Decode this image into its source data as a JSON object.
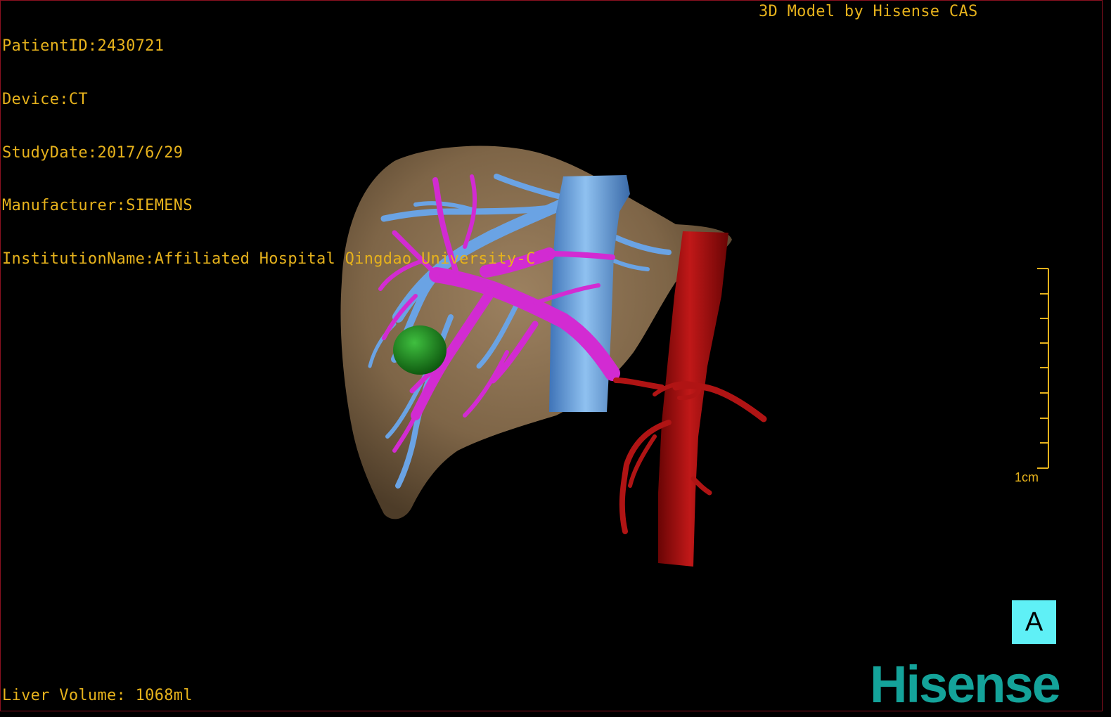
{
  "header": {
    "patient_id": "PatientID:2430721",
    "device": "Device:CT",
    "study_date": "StudyDate:2017/6/29",
    "manufacturer": "Manufacturer:SIEMENS",
    "institution": "InstitutionName:Affiliated Hospital Qingdao University-C"
  },
  "model_credit": "3D Model by Hisense CAS",
  "footer": {
    "liver_volume": "Liver Volume: 1068ml"
  },
  "scale_bar": {
    "label": "1cm"
  },
  "orientation": {
    "label": "A"
  },
  "brand": {
    "logo_text": "Hisense"
  },
  "structures": [
    {
      "name": "liver",
      "color": "#8b7150"
    },
    {
      "name": "hepatic-portal-veins",
      "color": "#d22bd2"
    },
    {
      "name": "hepatic-veins-ivc",
      "color": "#5f9be0"
    },
    {
      "name": "aorta",
      "color": "#a30f0f"
    },
    {
      "name": "lesion",
      "color": "#1f8a22"
    }
  ],
  "colors": {
    "overlay_text": "#e6b21c",
    "orientation_box": "#5ff0f6",
    "brand": "#14a39a"
  }
}
